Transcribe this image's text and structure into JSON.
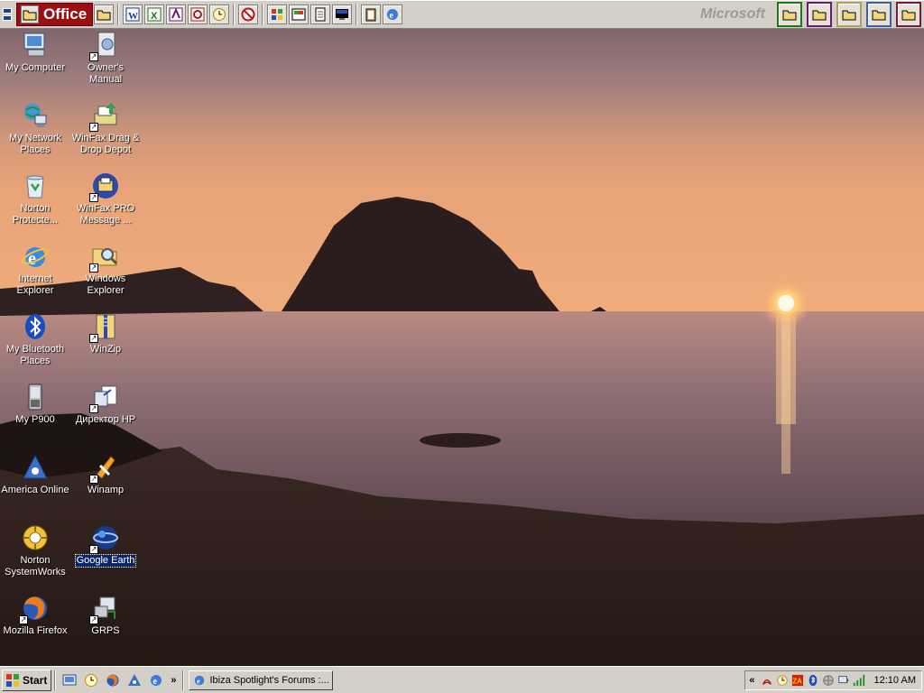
{
  "office_bar": {
    "title": "Office",
    "brand": "Microsoft",
    "buttons": [
      {
        "icon": "word-icon"
      },
      {
        "icon": "excel-icon"
      },
      {
        "icon": "publisher-icon"
      },
      {
        "icon": "outlook-icon"
      },
      {
        "icon": "clock-icon"
      },
      {
        "icon": "norton-icon"
      },
      {
        "icon": "windows-icon"
      },
      {
        "icon": "windows-explorer-icon"
      },
      {
        "icon": "document-icon"
      },
      {
        "icon": "display-icon"
      },
      {
        "icon": "clipboard-icon"
      },
      {
        "icon": "ie-icon"
      }
    ],
    "folder_colors": [
      "#1a7a1a",
      "#6a1a6a",
      "#b0a060",
      "#4060a0",
      "#7a1a3a"
    ]
  },
  "desktop": {
    "icons": [
      {
        "label": "My Computer",
        "icon": "my-computer-icon"
      },
      {
        "label": "Owner's Manual",
        "icon": "manual-icon"
      },
      {
        "label": "My Network Places",
        "icon": "network-places-icon"
      },
      {
        "label": "WinFax Drag & Drop Depot",
        "icon": "winfax-depot-icon"
      },
      {
        "label": "Norton Protecte...",
        "icon": "recycle-bin-icon"
      },
      {
        "label": "WinFax PRO Message ...",
        "icon": "winfax-message-icon"
      },
      {
        "label": "Internet Explorer",
        "icon": "internet-explorer-icon"
      },
      {
        "label": "Windows Explorer",
        "icon": "windows-explorer-icon"
      },
      {
        "label": "My Bluetooth Places",
        "icon": "bluetooth-icon"
      },
      {
        "label": "WinZip",
        "icon": "winzip-icon"
      },
      {
        "label": "My P900",
        "icon": "phone-icon"
      },
      {
        "label": "Директор HP",
        "icon": "hp-director-icon"
      },
      {
        "label": "America Online",
        "icon": "aol-icon"
      },
      {
        "label": "Winamp",
        "icon": "winamp-icon"
      },
      {
        "label": "Norton SystemWorks",
        "icon": "norton-systemworks-icon"
      },
      {
        "label": "Google Earth",
        "icon": "google-earth-icon"
      },
      {
        "label": "Mozilla Firefox",
        "icon": "firefox-icon"
      },
      {
        "label": "GRPS",
        "icon": "grps-icon"
      }
    ],
    "selected": "Google Earth"
  },
  "taskbar": {
    "start_label": "Start",
    "quick_launch": [
      "show-desktop-icon",
      "clock-icon",
      "firefox-icon",
      "aol-icon",
      "ie-icon"
    ],
    "more": "»",
    "task_title": "Ibiza Spotlight's Forums :...",
    "tray_chevron": "«",
    "tray_icons": [
      "acrobat-icon",
      "clock-icon",
      "zonealarm-icon",
      "bluetooth-icon",
      "network-icon",
      "volume-icon",
      "signal-icon"
    ],
    "clock": "12:10 AM"
  }
}
